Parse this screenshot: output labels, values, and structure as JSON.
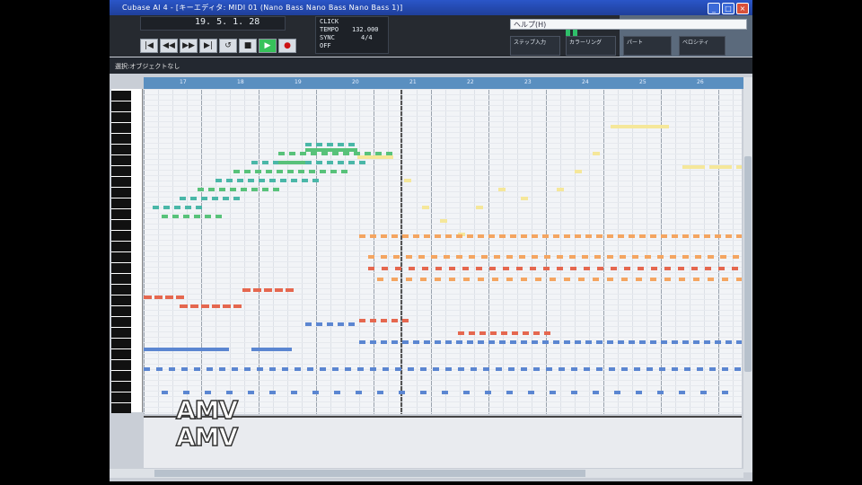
{
  "window": {
    "title": "Cubase AI 4 - [キーエディタ: MIDI 01 (Nano Bass Nano Bass Nano Bass 1)]",
    "minimize_label": "_",
    "maximize_label": "□",
    "close_label": "×"
  },
  "transport": {
    "position": "19. 5. 1. 28",
    "buttons": [
      "|◀",
      "◀◀",
      "▶▶",
      "▶|",
      "↺",
      "■",
      "▶",
      "●"
    ],
    "tempo_labels": [
      "CLICK",
      "TEMPO",
      "SYNC",
      "OFF"
    ],
    "time_readout": "132.000",
    "signature": "4/4"
  },
  "help": {
    "text": "ヘルプ(H)",
    "fields": [
      "ステップ入力",
      "カラーリング",
      "パート",
      "ベロシティ"
    ]
  },
  "status": {
    "text": "選択:オブジェクトなし"
  },
  "ruler": {
    "labels": [
      "17",
      "18",
      "19",
      "20",
      "21",
      "22",
      "23",
      "24",
      "25",
      "26",
      "27"
    ]
  },
  "watermark": {
    "text": "AMV"
  },
  "colors": {
    "green": "#58c27a",
    "teal": "#4ab7a8",
    "yellow": "#f5e79a",
    "orange": "#f4a561",
    "red": "#e5674f",
    "blue": "#5b86d1"
  }
}
